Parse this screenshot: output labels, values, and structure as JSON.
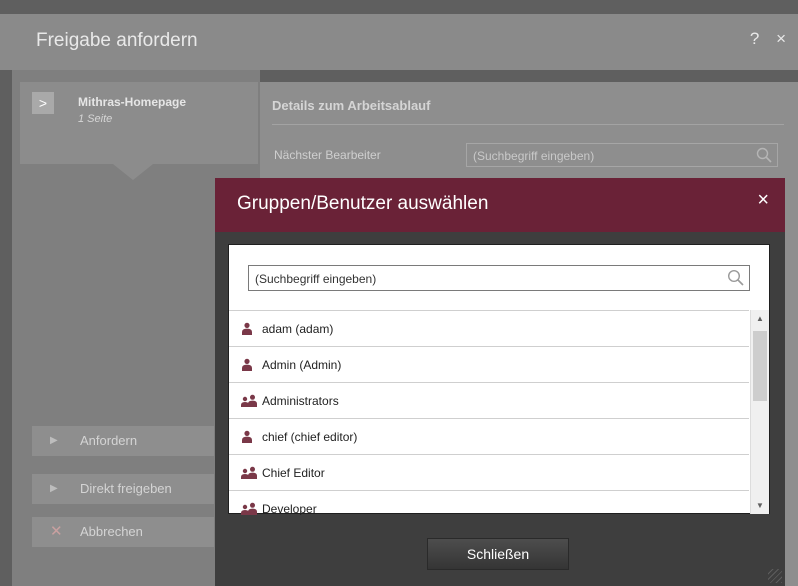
{
  "background_dialog": {
    "title": "Freigabe anfordern",
    "controls": "? ×",
    "project": {
      "name": "Mithras-Homepage",
      "sub": "1 Seite",
      "arrow": ">"
    },
    "details": {
      "heading": "Details zum Arbeitsablauf",
      "next_editor_label": "Nächster Bearbeiter",
      "next_editor_placeholder": "(Suchbegriff eingeben)"
    },
    "actions": [
      {
        "label": "Anfordern",
        "icon": "▶"
      },
      {
        "label": "Direkt freigeben",
        "icon": "▶"
      },
      {
        "label": "Abbrechen",
        "icon": "✕"
      }
    ]
  },
  "modal": {
    "title": "Gruppen/Benutzer auswählen",
    "close": "×",
    "search_placeholder": "(Suchbegriff eingeben)",
    "items": [
      {
        "label": "adam (adam)",
        "icon": "user-icon"
      },
      {
        "label": "Admin (Admin)",
        "icon": "user-icon"
      },
      {
        "label": "Administrators",
        "icon": "group-icon"
      },
      {
        "label": "chief (chief editor)",
        "icon": "user-icon"
      },
      {
        "label": "Chief Editor",
        "icon": "group-icon"
      },
      {
        "label": "Developer",
        "icon": "group-icon"
      }
    ],
    "close_button": "Schließen"
  },
  "colors": {
    "modal_title_bg": "#6a2237",
    "modal_body_bg": "#3e3e3e",
    "icon_color": "#7a3848"
  }
}
